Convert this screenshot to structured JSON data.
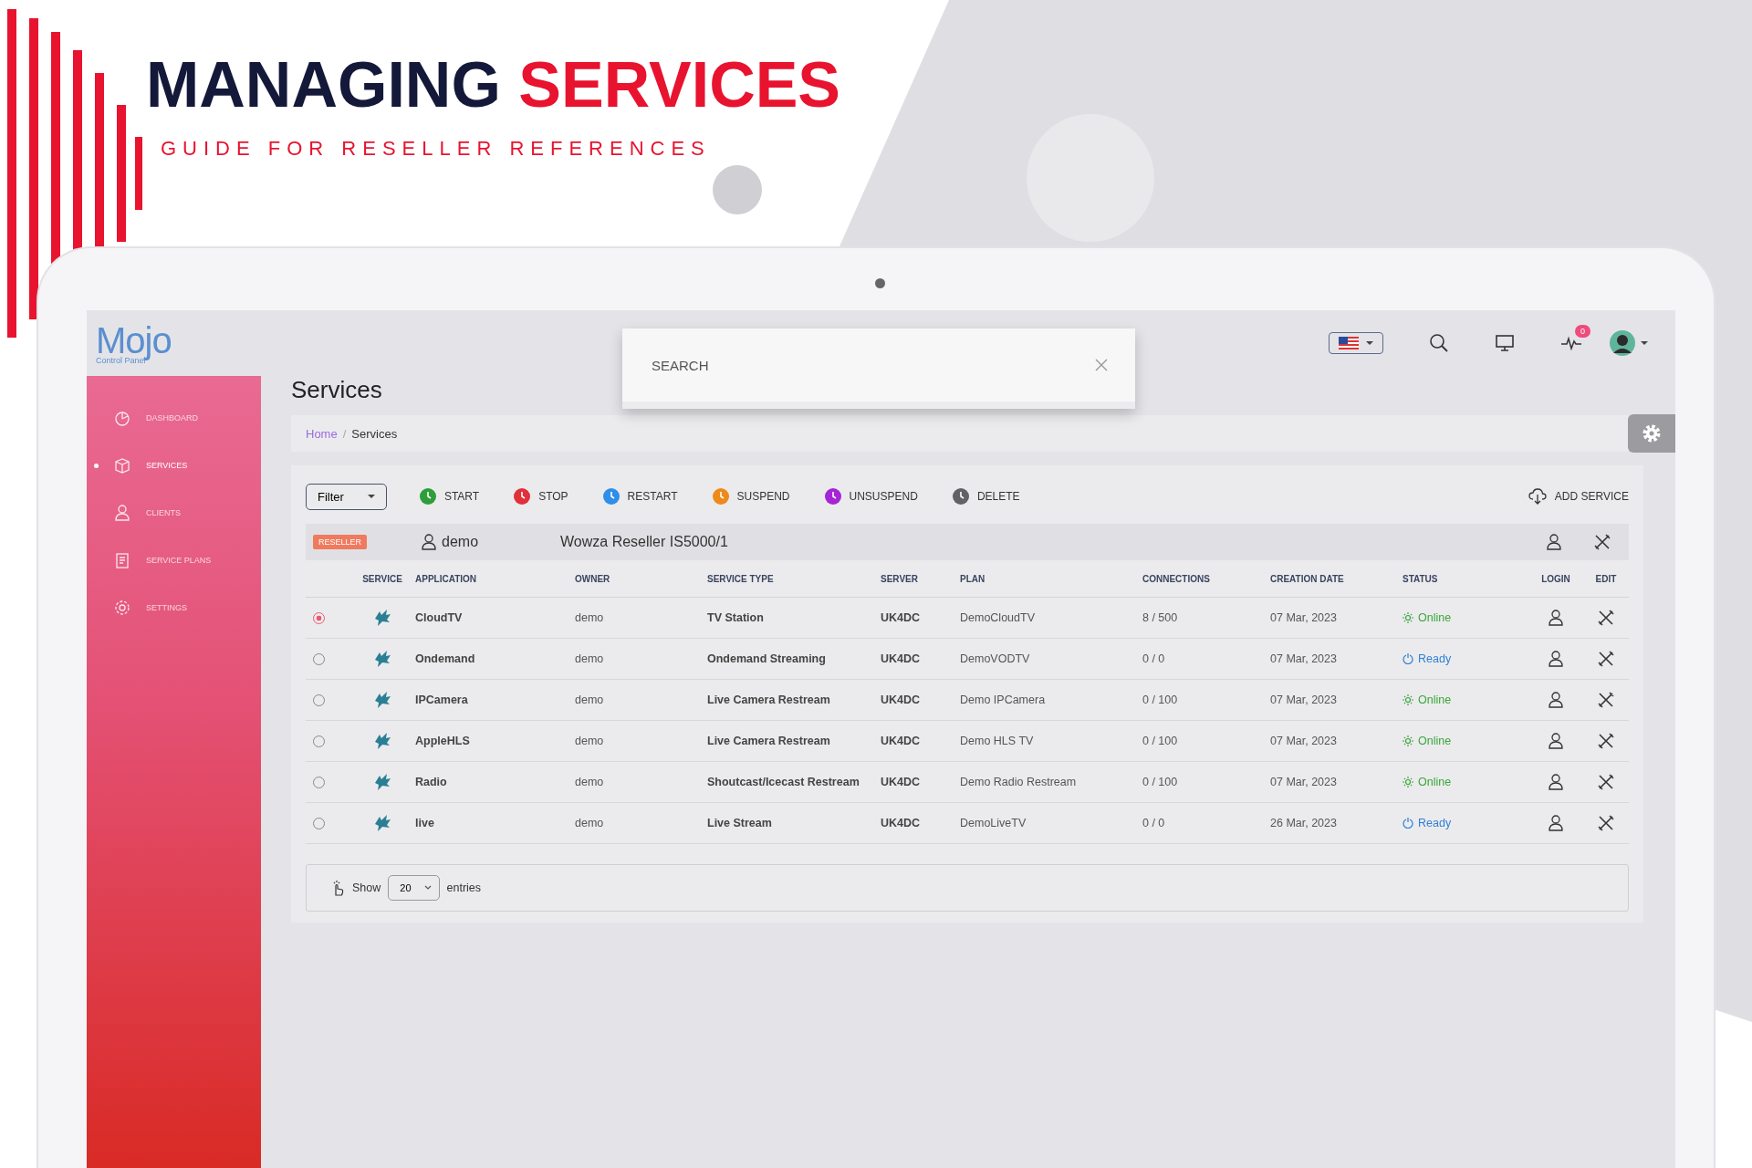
{
  "banner": {
    "title_dark": "MANAGING",
    "title_accent": "SERVICES",
    "subtitle": "GUIDE FOR RESELLER REFERENCES"
  },
  "logo": {
    "name": "Mojo",
    "tagline": "Control Panel"
  },
  "topbar": {
    "notifications": "0"
  },
  "sidebar": {
    "items": [
      {
        "label": "DASHBOARD",
        "selected": false
      },
      {
        "label": "SERVICES",
        "selected": true
      },
      {
        "label": "CLIENTS",
        "selected": false
      },
      {
        "label": "SERVICE PLANS",
        "selected": false
      },
      {
        "label": "SETTINGS",
        "selected": false
      }
    ]
  },
  "page_title": "Services",
  "search": {
    "placeholder": "SEARCH"
  },
  "breadcrumb": {
    "items": [
      "Home",
      "Services"
    ],
    "separator": "/"
  },
  "toolbar": {
    "filter": "Filter",
    "actions": [
      {
        "label": "START",
        "color": "#2e9e3a"
      },
      {
        "label": "STOP",
        "color": "#e0303a"
      },
      {
        "label": "RESTART",
        "color": "#2f8ee8"
      },
      {
        "label": "SUSPEND",
        "color": "#ee8a1a"
      },
      {
        "label": "UNSUSPEND",
        "color": "#a424d6"
      },
      {
        "label": "DELETE",
        "color": "#606266"
      }
    ],
    "add_service": "ADD SERVICE"
  },
  "group": {
    "badge": "RESELLER",
    "owner": "demo",
    "name": "Wowza Reseller IS5000/1"
  },
  "table": {
    "columns": [
      "SERVICE",
      "APPLICATION",
      "OWNER",
      "SERVICE TYPE",
      "SERVER",
      "PLAN",
      "CONNECTIONS",
      "CREATION DATE",
      "STATUS",
      "LOGIN",
      "EDIT"
    ],
    "rows": [
      {
        "selected": true,
        "application": "CloudTV",
        "owner": "demo",
        "service_type": "TV Station",
        "server": "UK4DC",
        "plan": "DemoCloudTV",
        "connections": "8 / 500",
        "creation_date": "07 Mar, 2023",
        "status": {
          "kind": "online",
          "label": "Online"
        }
      },
      {
        "selected": false,
        "application": "Ondemand",
        "owner": "demo",
        "service_type": "Ondemand Streaming",
        "server": "UK4DC",
        "plan": "DemoVODTV",
        "connections": "0 / 0",
        "creation_date": "07 Mar, 2023",
        "status": {
          "kind": "ready",
          "label": "Ready"
        }
      },
      {
        "selected": false,
        "application": "IPCamera",
        "owner": "demo",
        "service_type": "Live Camera Restream",
        "server": "UK4DC",
        "plan": "Demo IPCamera",
        "connections": "0 / 100",
        "creation_date": "07 Mar, 2023",
        "status": {
          "kind": "online",
          "label": "Online"
        }
      },
      {
        "selected": false,
        "application": "AppleHLS",
        "owner": "demo",
        "service_type": "Live Camera Restream",
        "server": "UK4DC",
        "plan": "Demo HLS TV",
        "connections": "0 / 100",
        "creation_date": "07 Mar, 2023",
        "status": {
          "kind": "online",
          "label": "Online"
        }
      },
      {
        "selected": false,
        "application": "Radio",
        "owner": "demo",
        "service_type": "Shoutcast/Icecast Restream",
        "server": "UK4DC",
        "plan": "Demo Radio Restream",
        "connections": "0 / 100",
        "creation_date": "07 Mar, 2023",
        "status": {
          "kind": "online",
          "label": "Online"
        }
      },
      {
        "selected": false,
        "application": "live",
        "owner": "demo",
        "service_type": "Live Stream",
        "server": "UK4DC",
        "plan": "DemoLiveTV",
        "connections": "0 / 0",
        "creation_date": "26 Mar, 2023",
        "status": {
          "kind": "ready",
          "label": "Ready"
        }
      }
    ]
  },
  "pagination": {
    "show": "Show",
    "page_size": "20",
    "entries": "entries"
  }
}
